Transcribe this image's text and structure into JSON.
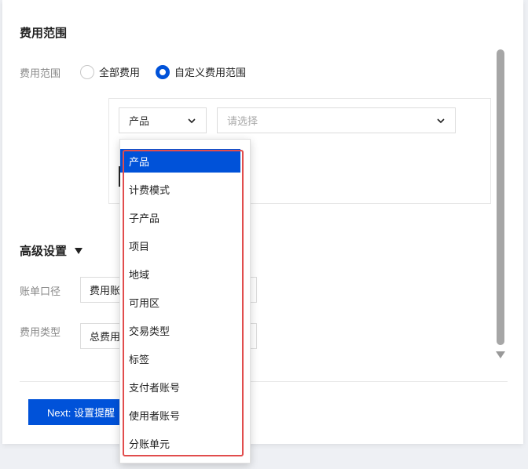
{
  "section": {
    "title": "费用范围"
  },
  "scope": {
    "label": "费用范围",
    "options": [
      {
        "label": "全部费用",
        "checked": false
      },
      {
        "label": "自定义费用范围",
        "checked": true
      }
    ]
  },
  "filter": {
    "dimension_value": "产品",
    "value_placeholder": "请选择"
  },
  "dropdown": {
    "items": [
      "产品",
      "计费模式",
      "子产品",
      "项目",
      "地域",
      "可用区",
      "交易类型",
      "标签",
      "支付者账号",
      "使用者账号",
      "分账单元"
    ],
    "selected": "产品"
  },
  "advanced": {
    "title": "高级设置",
    "bill_basis_label": "账单口径",
    "bill_basis_value": "费用账",
    "fee_type_label": "费用类型",
    "fee_type_value": "总费用"
  },
  "footer": {
    "next_label": "Next: 设置提醒"
  },
  "colors": {
    "accent": "#0052d9",
    "highlight": "#e14d4d"
  }
}
